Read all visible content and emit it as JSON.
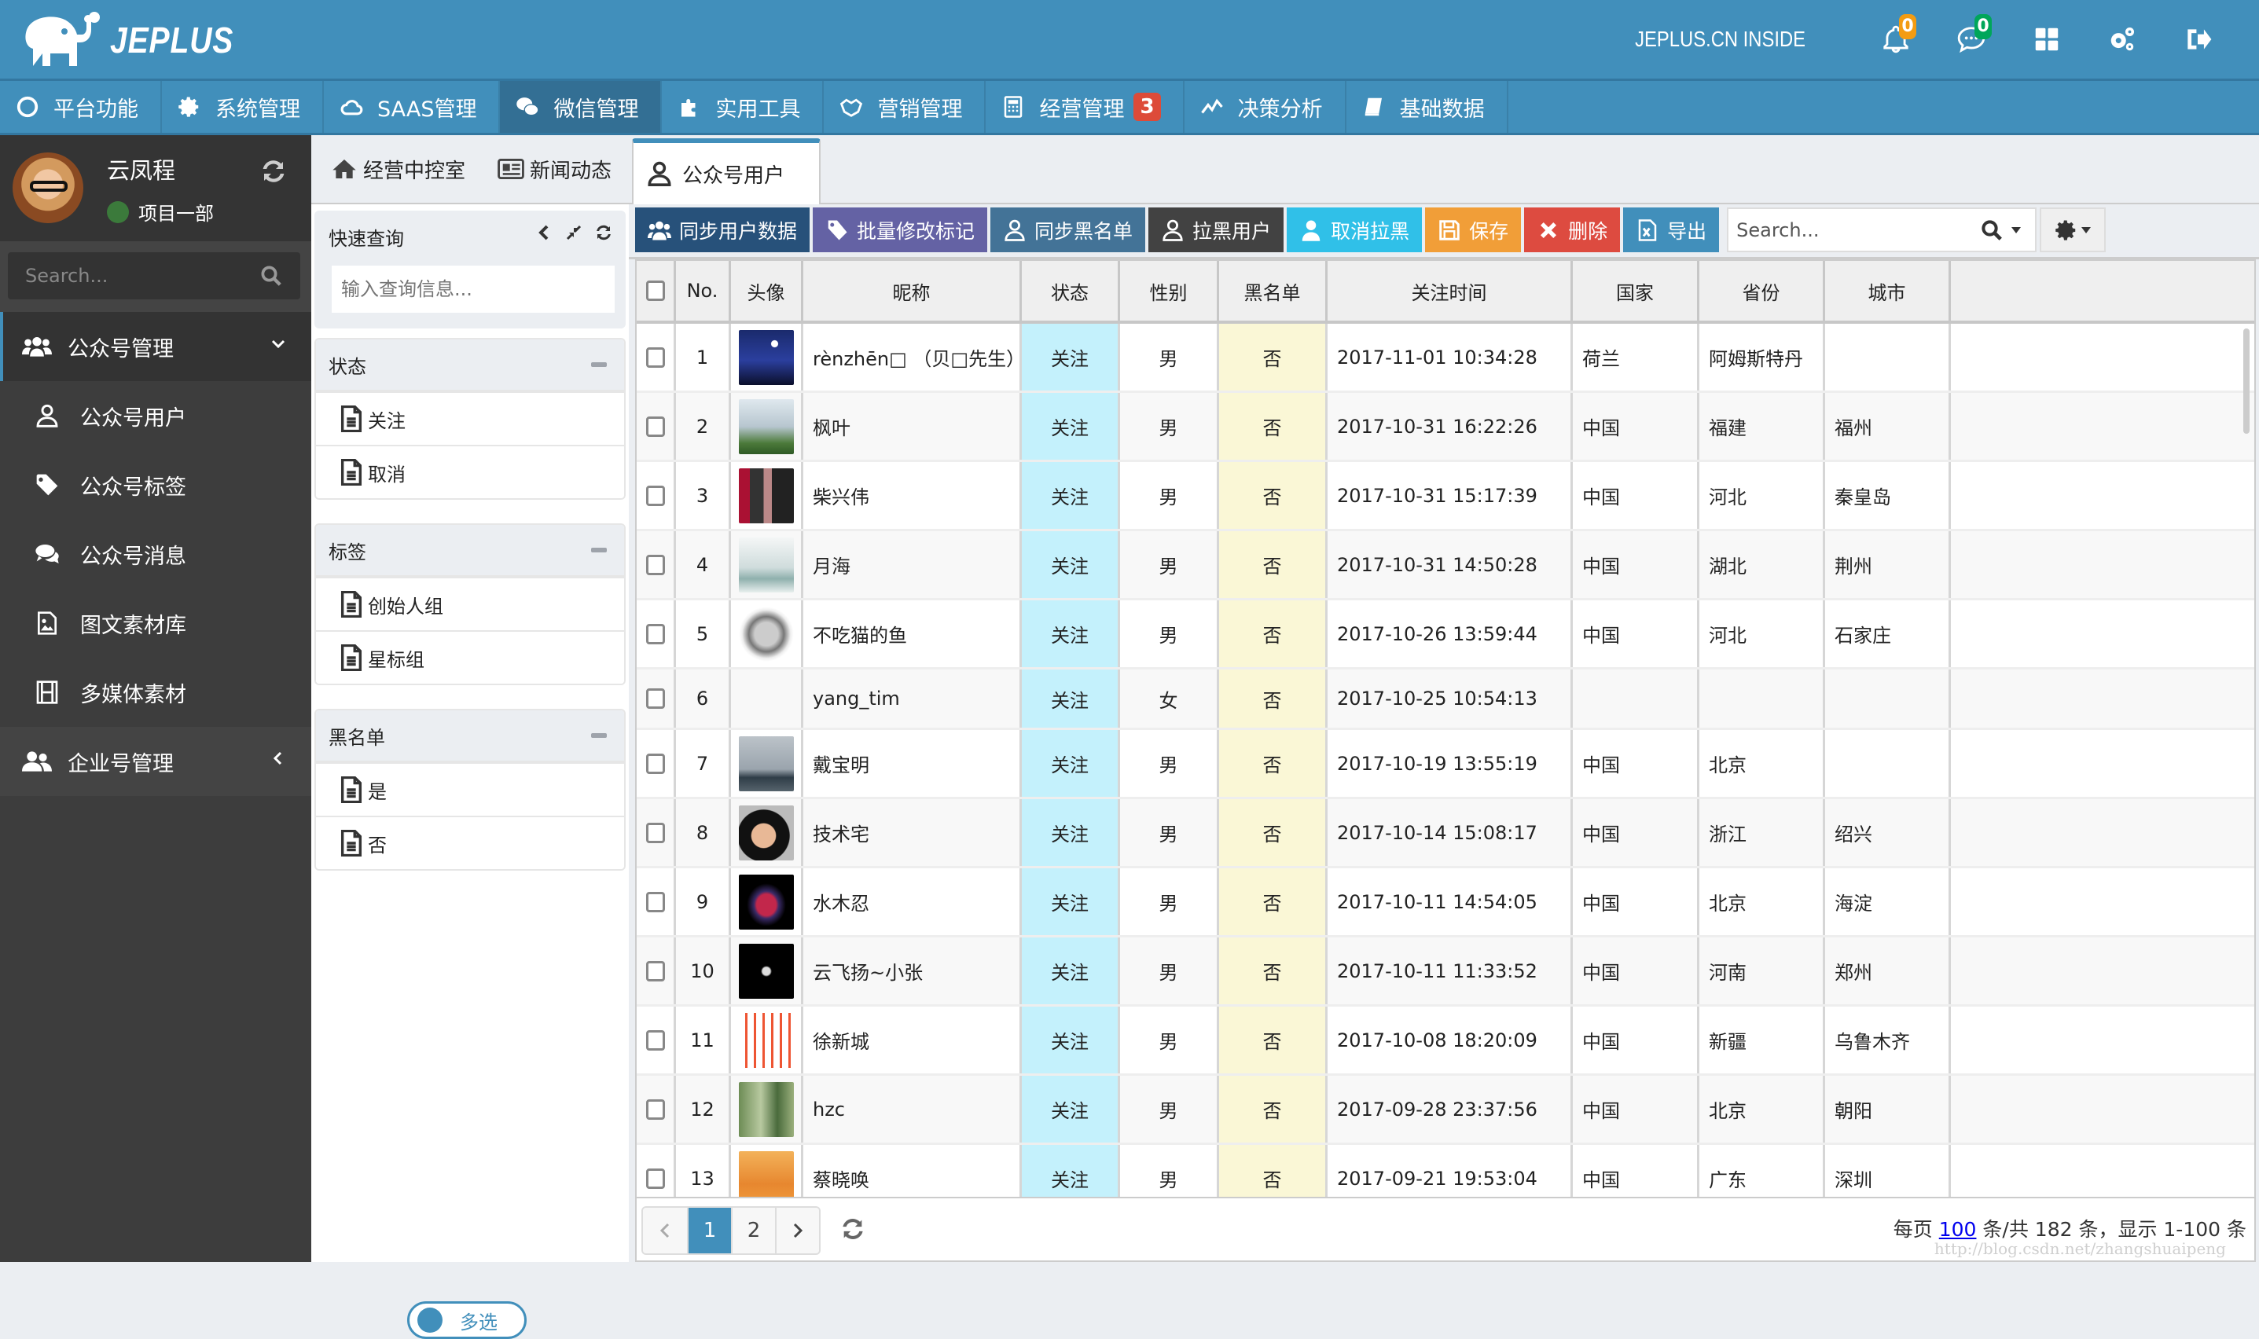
{
  "header": {
    "brand": "JEPLUS",
    "site_label": "JEPLUS.CN INSIDE",
    "notifications_count": "0",
    "messages_count": "0",
    "badge_colors": {
      "notifications": "#f39c12",
      "messages": "#00a65a"
    }
  },
  "nav": {
    "items": [
      {
        "label": "平台功能",
        "icon": "circle-icon"
      },
      {
        "label": "系统管理",
        "icon": "gear-icon"
      },
      {
        "label": "SAAS管理",
        "icon": "cloud-icon"
      },
      {
        "label": "微信管理",
        "icon": "wechat-icon",
        "active": true
      },
      {
        "label": "实用工具",
        "icon": "puzzle-icon"
      },
      {
        "label": "营销管理",
        "icon": "handshake-icon"
      },
      {
        "label": "经营管理",
        "icon": "calculator-icon",
        "badge": "3"
      },
      {
        "label": "决策分析",
        "icon": "line-chart-icon"
      },
      {
        "label": "基础数据",
        "icon": "book-icon"
      }
    ]
  },
  "sidebar": {
    "user_name": "云凤程",
    "user_dept": "项目一部",
    "search_placeholder": "Search...",
    "groups": [
      {
        "label": "公众号管理",
        "expanded": true,
        "items": [
          {
            "label": "公众号用户",
            "icon": "user-icon"
          },
          {
            "label": "公众号标签",
            "icon": "tag-icon"
          },
          {
            "label": "公众号消息",
            "icon": "comments-icon"
          },
          {
            "label": "图文素材库",
            "icon": "image-file-icon"
          },
          {
            "label": "多媒体素材",
            "icon": "film-icon"
          }
        ]
      },
      {
        "label": "企业号管理",
        "expanded": false,
        "items": []
      }
    ]
  },
  "tabs": {
    "home": "经营中控室",
    "news": "新闻动态",
    "active": "公众号用户"
  },
  "filter": {
    "quick_title": "快速查询",
    "quick_placeholder": "输入查询信息...",
    "groups": [
      {
        "title": "状态",
        "items": [
          "关注",
          "取消"
        ]
      },
      {
        "title": "标签",
        "items": [
          "创始人组",
          "星标组"
        ]
      },
      {
        "title": "黑名单",
        "items": [
          "是",
          "否"
        ]
      }
    ],
    "multi_select_label": "多选"
  },
  "toolbar": {
    "buttons": [
      {
        "label": "同步用户数据",
        "color": "#27517a",
        "icon": "users-icon"
      },
      {
        "label": "批量修改标记",
        "color": "#6462a4",
        "icon": "tag-icon"
      },
      {
        "label": "同步黑名单",
        "color": "#437397",
        "icon": "user-icon"
      },
      {
        "label": "拉黑用户",
        "color": "#424242",
        "icon": "user-icon"
      },
      {
        "label": "取消拉黑",
        "color": "#30c0e8",
        "icon": "user-solid-icon"
      },
      {
        "label": "保存",
        "color": "#f19e38",
        "icon": "save-icon"
      },
      {
        "label": "删除",
        "color": "#dd4b40",
        "icon": "close-icon"
      },
      {
        "label": "导出",
        "color": "#418fbb",
        "icon": "excel-file-icon"
      }
    ],
    "search_placeholder": "Search..."
  },
  "table": {
    "columns": [
      "No.",
      "头像",
      "昵称",
      "状态",
      "性别",
      "黑名单",
      "关注时间",
      "国家",
      "省份",
      "城市"
    ],
    "rows": [
      {
        "no": "1",
        "avatar": "night-sky",
        "nickname": "rènzhēn□ （贝□先生）",
        "status": "关注",
        "gender": "男",
        "blacklist": "否",
        "time": "2017-11-01 10:34:28",
        "country": "荷兰",
        "province": "阿姆斯特丹",
        "city": ""
      },
      {
        "no": "2",
        "avatar": "mountain-hiker",
        "nickname": "枫叶",
        "status": "关注",
        "gender": "男",
        "blacklist": "否",
        "time": "2017-10-31 16:22:26",
        "country": "中国",
        "province": "福建",
        "city": "福州"
      },
      {
        "no": "3",
        "avatar": "family-photo",
        "nickname": "柴兴伟",
        "status": "关注",
        "gender": "男",
        "blacklist": "否",
        "time": "2017-10-31 15:17:39",
        "country": "中国",
        "province": "河北",
        "city": "秦皇岛"
      },
      {
        "no": "4",
        "avatar": "ink-landscape",
        "nickname": "月海",
        "status": "关注",
        "gender": "男",
        "blacklist": "否",
        "time": "2017-10-31 14:50:28",
        "country": "中国",
        "province": "湖北",
        "city": "荆州"
      },
      {
        "no": "5",
        "avatar": "ink-circle",
        "nickname": "不吃猫的鱼",
        "status": "关注",
        "gender": "男",
        "blacklist": "否",
        "time": "2017-10-26 13:59:44",
        "country": "中国",
        "province": "河北",
        "city": "石家庄"
      },
      {
        "no": "6",
        "avatar": "",
        "nickname": "yang_tim",
        "status": "关注",
        "gender": "女",
        "blacklist": "否",
        "time": "2017-10-25 10:54:13",
        "country": "",
        "province": "",
        "city": ""
      },
      {
        "no": "7",
        "avatar": "sea-tower",
        "nickname": "戴宝明",
        "status": "关注",
        "gender": "男",
        "blacklist": "否",
        "time": "2017-10-19 13:55:19",
        "country": "中国",
        "province": "北京",
        "city": ""
      },
      {
        "no": "8",
        "avatar": "smiling-man",
        "nickname": "技术宅",
        "status": "关注",
        "gender": "男",
        "blacklist": "否",
        "time": "2017-10-14 15:08:17",
        "country": "中国",
        "province": "浙江",
        "city": "绍兴"
      },
      {
        "no": "9",
        "avatar": "red-car",
        "nickname": "水木忍",
        "status": "关注",
        "gender": "男",
        "blacklist": "否",
        "time": "2017-10-11 14:54:05",
        "country": "中国",
        "province": "北京",
        "city": "海淀"
      },
      {
        "no": "10",
        "avatar": "dark-face",
        "nickname": "云飞扬~小张",
        "status": "关注",
        "gender": "男",
        "blacklist": "否",
        "time": "2017-10-11 11:33:52",
        "country": "中国",
        "province": "河南",
        "city": "郑州"
      },
      {
        "no": "11",
        "avatar": "red-seal",
        "nickname": "徐新城",
        "status": "关注",
        "gender": "男",
        "blacklist": "否",
        "time": "2017-10-08 18:20:09",
        "country": "中国",
        "province": "新疆",
        "city": "乌鲁木齐"
      },
      {
        "no": "12",
        "avatar": "green-cliffs",
        "nickname": "hzc",
        "status": "关注",
        "gender": "男",
        "blacklist": "否",
        "time": "2017-09-28 23:37:56",
        "country": "中国",
        "province": "北京",
        "city": "朝阳"
      },
      {
        "no": "13",
        "avatar": "orange-art",
        "nickname": "蔡晓唤",
        "status": "关注",
        "gender": "男",
        "blacklist": "否",
        "time": "2017-09-21 19:53:04",
        "country": "中国",
        "province": "广东",
        "city": "深圳"
      }
    ]
  },
  "pagination": {
    "pages": [
      "1",
      "2"
    ],
    "current": "1",
    "info_prefix": "每页",
    "page_size": "100",
    "info_suffix": "条/共 182 条，显示 1-100 条",
    "watermark": "http://blog.csdn.net/zhangshuaipeng"
  },
  "colors": {
    "brand": "#418fbb",
    "sidebar": "#3d3d3d",
    "status_cell": "#c4f1fc",
    "blacklist_cell": "#faf7d6"
  }
}
